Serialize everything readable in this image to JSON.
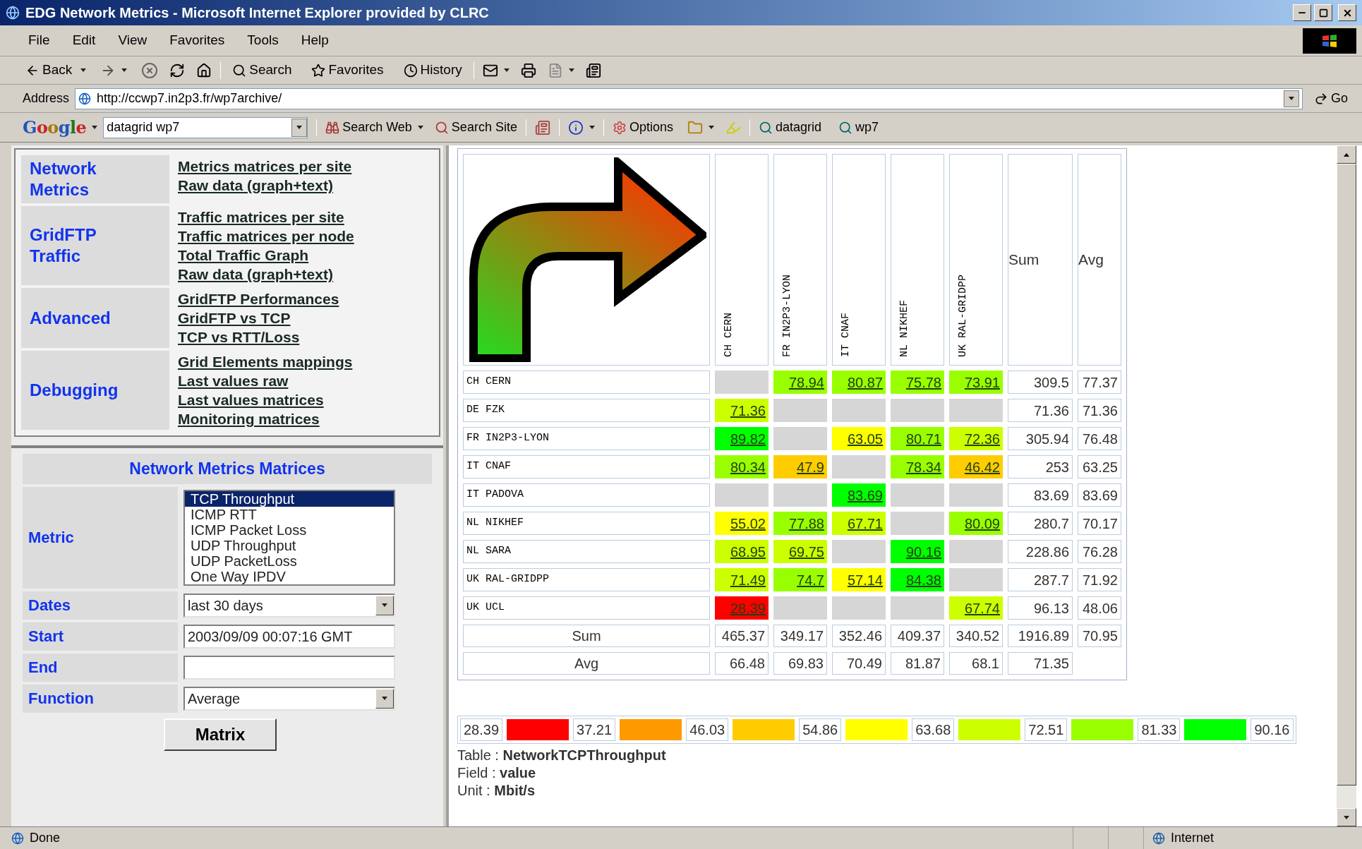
{
  "window": {
    "title": "EDG Network Metrics - Microsoft Internet Explorer provided by CLRC"
  },
  "menu": [
    "File",
    "Edit",
    "View",
    "Favorites",
    "Tools",
    "Help"
  ],
  "toolbar": {
    "back": "Back",
    "search": "Search",
    "favorites": "Favorites",
    "history": "History"
  },
  "address": {
    "label": "Address",
    "url": "http://ccwp7.in2p3.fr/wp7archive/",
    "go": "Go"
  },
  "google_bar": {
    "logo": "Google",
    "query": "datagrid wp7",
    "search_web": "Search Web",
    "search_site": "Search Site",
    "options": "Options",
    "bookmarks": [
      "datagrid",
      "wp7"
    ]
  },
  "nav": [
    {
      "title": "Network Metrics",
      "links": [
        "Metrics matrices per site",
        "Raw data (graph+text)"
      ]
    },
    {
      "title": "GridFTP Traffic",
      "links": [
        "Traffic matrices per site",
        "Traffic matrices per node",
        "Total Traffic Graph",
        "Raw data (graph+text)"
      ]
    },
    {
      "title": "Advanced",
      "links": [
        "GridFTP Performances",
        "GridFTP vs TCP",
        "TCP vs RTT/Loss"
      ]
    },
    {
      "title": "Debugging",
      "links": [
        "Grid Elements mappings",
        "Last values raw",
        "Last values matrices",
        "Monitoring matrices"
      ]
    }
  ],
  "form": {
    "title": "Network Metrics Matrices",
    "metric_label": "Metric",
    "metrics": [
      {
        "label": "TCP Throughput",
        "selected": true
      },
      {
        "label": "ICMP RTT",
        "selected": false
      },
      {
        "label": "ICMP Packet Loss",
        "selected": false
      },
      {
        "label": "UDP Throughput",
        "selected": false
      },
      {
        "label": "UDP PacketLoss",
        "selected": false
      },
      {
        "label": "One Way IPDV",
        "selected": false
      }
    ],
    "dates_label": "Dates",
    "dates": "last 30 days",
    "start_label": "Start",
    "start": "2003/09/09 00:07:16 GMT",
    "end_label": "End",
    "function_label": "Function",
    "function": "Average",
    "submit": "Matrix"
  },
  "matrix": {
    "columns": [
      "CH CERN",
      "FR IN2P3-LYON",
      "IT CNAF",
      "NL NIKHEF",
      "UK RAL-GRIDPP"
    ],
    "sum_header": "Sum",
    "avg_header": "Avg",
    "rows": [
      {
        "name": "CH CERN",
        "cells": [
          null,
          {
            "value": "78.94",
            "color": "#99ff00"
          },
          {
            "value": "80.87",
            "color": "#99ff00"
          },
          {
            "value": "75.78",
            "color": "#99ff00"
          },
          {
            "value": "73.91",
            "color": "#99ff00"
          }
        ],
        "sum": "309.5",
        "avg": "77.37"
      },
      {
        "name": "DE FZK",
        "cells": [
          {
            "value": "71.36",
            "color": "#ccff00"
          },
          null,
          null,
          null,
          null
        ],
        "sum": "71.36",
        "avg": "71.36"
      },
      {
        "name": "FR IN2P3-LYON",
        "cells": [
          {
            "value": "89.82",
            "color": "#00ff00"
          },
          null,
          {
            "value": "63.05",
            "color": "#ffff00"
          },
          {
            "value": "80.71",
            "color": "#99ff00"
          },
          {
            "value": "72.36",
            "color": "#ccff00"
          }
        ],
        "sum": "305.94",
        "avg": "76.48"
      },
      {
        "name": "IT CNAF",
        "cells": [
          {
            "value": "80.34",
            "color": "#99ff00"
          },
          {
            "value": "47.9",
            "color": "#ffcc00"
          },
          null,
          {
            "value": "78.34",
            "color": "#99ff00"
          },
          {
            "value": "46.42",
            "color": "#ffcc00"
          }
        ],
        "sum": "253",
        "avg": "63.25"
      },
      {
        "name": "IT PADOVA",
        "cells": [
          null,
          null,
          {
            "value": "83.69",
            "color": "#00ff00"
          },
          null,
          null
        ],
        "sum": "83.69",
        "avg": "83.69"
      },
      {
        "name": "NL NIKHEF",
        "cells": [
          {
            "value": "55.02",
            "color": "#ffff00"
          },
          {
            "value": "77.88",
            "color": "#99ff00"
          },
          {
            "value": "67.71",
            "color": "#ccff00"
          },
          null,
          {
            "value": "80.09",
            "color": "#99ff00"
          }
        ],
        "sum": "280.7",
        "avg": "70.17"
      },
      {
        "name": "NL SARA",
        "cells": [
          {
            "value": "68.95",
            "color": "#ccff00"
          },
          {
            "value": "69.75",
            "color": "#ccff00"
          },
          null,
          {
            "value": "90.16",
            "color": "#00ff00"
          },
          null
        ],
        "sum": "228.86",
        "avg": "76.28"
      },
      {
        "name": "UK RAL-GRIDPP",
        "cells": [
          {
            "value": "71.49",
            "color": "#ccff00"
          },
          {
            "value": "74.7",
            "color": "#99ff00"
          },
          {
            "value": "57.14",
            "color": "#ffff00"
          },
          {
            "value": "84.38",
            "color": "#00ff00"
          },
          null
        ],
        "sum": "287.7",
        "avg": "71.92"
      },
      {
        "name": "UK UCL",
        "cells": [
          {
            "value": "28.39",
            "color": "#ff0000"
          },
          null,
          null,
          null,
          {
            "value": "67.74",
            "color": "#ccff00"
          }
        ],
        "sum": "96.13",
        "avg": "48.06"
      }
    ],
    "totals": [
      {
        "label": "Sum",
        "values": [
          "465.37",
          "349.17",
          "352.46",
          "409.37",
          "340.52",
          "1916.89",
          "70.95"
        ]
      },
      {
        "label": "Avg",
        "values": [
          "66.48",
          "69.83",
          "70.49",
          "81.87",
          "68.1",
          "71.35"
        ]
      }
    ]
  },
  "legend": {
    "steps": [
      {
        "from": "28.39",
        "color": "#ff0000"
      },
      {
        "from": "37.21",
        "color": "#ff9900"
      },
      {
        "from": "46.03",
        "color": "#ffcc00"
      },
      {
        "from": "54.86",
        "color": "#ffff00"
      },
      {
        "from": "63.68",
        "color": "#ccff00"
      },
      {
        "from": "72.51",
        "color": "#99ff00"
      },
      {
        "from": "81.33",
        "color": "#00ff00"
      }
    ],
    "max": "90.16"
  },
  "info": [
    "Table : **NetworkTCPThroughput**",
    "Field : **value**",
    "Unit : **Mbit/s**"
  ],
  "status_bar": {
    "text": "Done",
    "zone": "Internet"
  }
}
